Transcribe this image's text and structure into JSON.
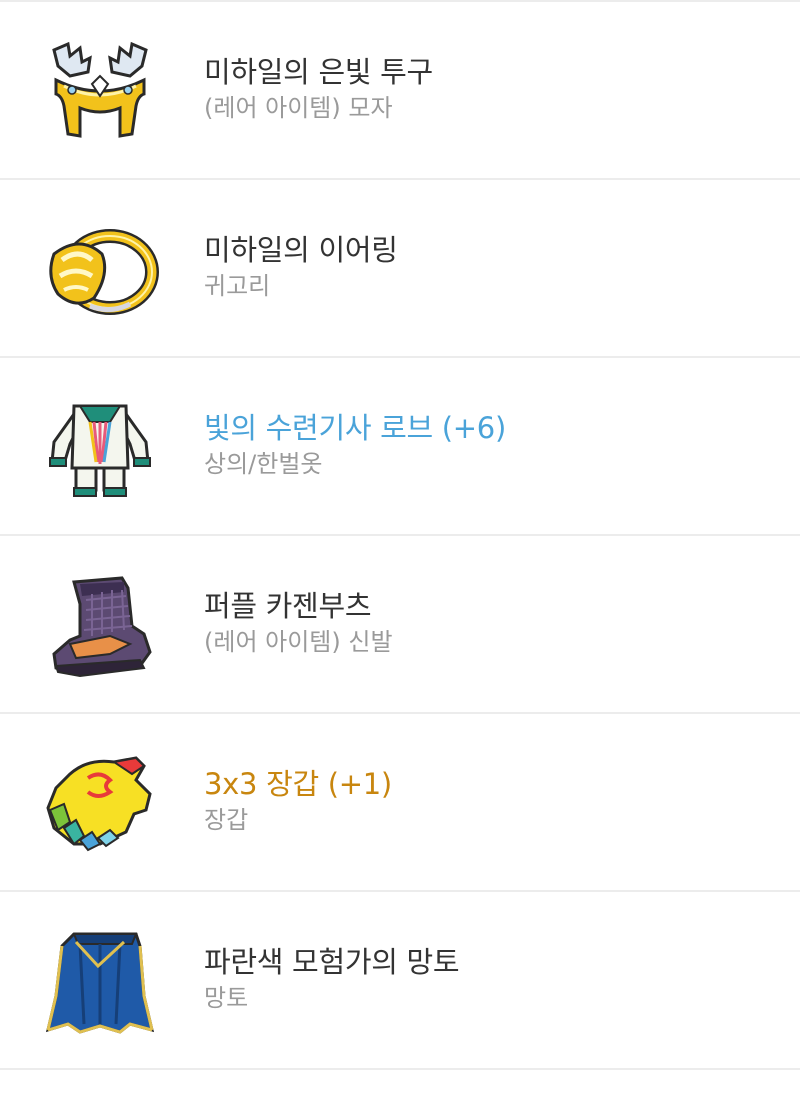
{
  "items": [
    {
      "name": "미하일의 은빛 투구",
      "category": "(레어 아이템) 모자",
      "name_color": "#333333",
      "icon": "winged-helmet-icon"
    },
    {
      "name": "미하일의 이어링",
      "category": "귀고리",
      "name_color": "#333333",
      "icon": "gold-earring-icon"
    },
    {
      "name": "빛의 수련기사 로브 (+6)",
      "category": "상의/한벌옷",
      "name_color": "#4aa3d9",
      "icon": "white-robe-icon"
    },
    {
      "name": "퍼플 카젠부츠",
      "category": "(레어 아이템) 신발",
      "name_color": "#333333",
      "icon": "purple-boots-icon"
    },
    {
      "name": "3x3 장갑 (+1)",
      "category": "장갑",
      "name_color": "#c8860f",
      "icon": "yellow-glove-icon"
    },
    {
      "name": "파란색 모험가의 망토",
      "category": "망토",
      "name_color": "#333333",
      "icon": "blue-cape-icon"
    }
  ]
}
